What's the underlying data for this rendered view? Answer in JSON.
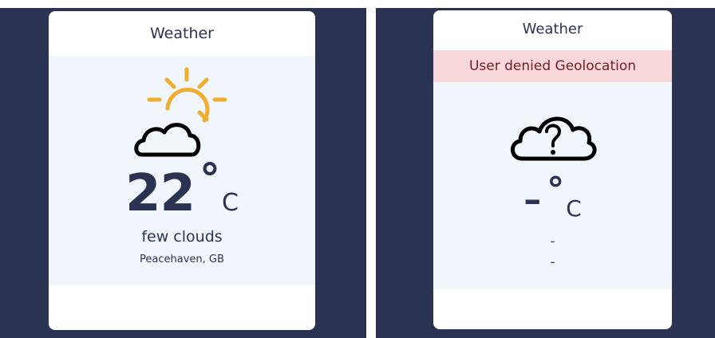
{
  "left_card": {
    "title": "Weather",
    "icon": "sun-behind-cloud-icon",
    "temp_value": "22",
    "temp_degree": "°",
    "temp_unit": "C",
    "description": "few clouds",
    "location": "Peacehaven, GB"
  },
  "right_card": {
    "title": "Weather",
    "error": "User denied Geolocation",
    "icon": "cloud-question-icon",
    "temp_value": "–",
    "temp_degree": "°",
    "temp_unit": "C",
    "description": "-",
    "location": "-"
  },
  "colors": {
    "background": "#2b3353",
    "card": "#ffffff",
    "card_body": "#f1f6fd",
    "text": "#2b3353",
    "sun": "#f0ad2e",
    "error_bg": "#f8d7da",
    "error_text": "#721c24"
  }
}
